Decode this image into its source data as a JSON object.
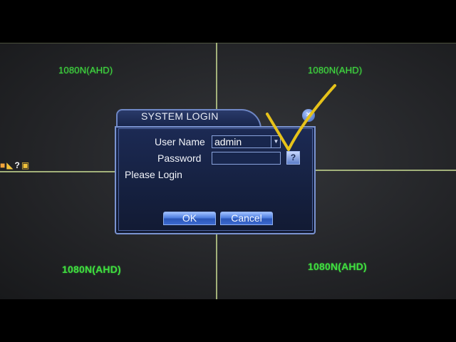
{
  "channels": [
    {
      "label": "1080N(AHD)"
    },
    {
      "label": "1080N(AHD)"
    },
    {
      "label": "1080N(AHD)"
    },
    {
      "label": "1080N(AHD)"
    }
  ],
  "dialog": {
    "title": "SYSTEM LOGIN",
    "username_label": "User Name",
    "username_value": "admin",
    "password_label": "Password",
    "password_value": "",
    "status": "Please Login",
    "ok_label": "OK",
    "cancel_label": "Cancel",
    "help_label": "?"
  },
  "colors": {
    "channel_label": "#3fe03f",
    "dialog_bg": "#15203f",
    "dialog_border": "#7a93d0",
    "button": "#4f7fe0",
    "annotation_check": "#e6c21a"
  },
  "icons": [
    "close-icon",
    "alarm-icon",
    "help-icon",
    "record-icon",
    "checkmark-annotation-icon"
  ]
}
